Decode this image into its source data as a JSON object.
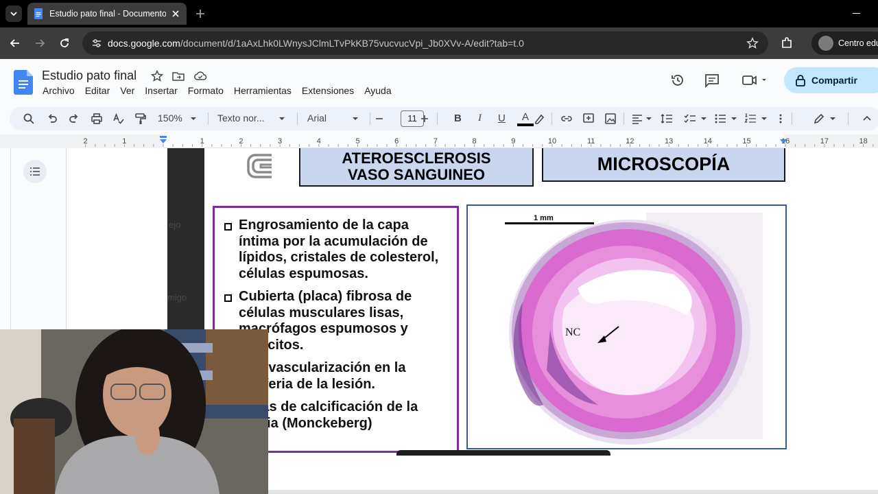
{
  "browser": {
    "tab_title": "Estudio pato final - Documento",
    "url_host": "docs.google.com",
    "url_path": "/document/d/1aAxLhk0LWnysJClmLTvPkKB75vucvucVpi_Jb0XVv-A/edit?tab=t.0",
    "profile_label": "Centro educ"
  },
  "docs": {
    "title": "Estudio pato final",
    "menu": [
      "Archivo",
      "Editar",
      "Ver",
      "Insertar",
      "Formato",
      "Herramientas",
      "Extensiones",
      "Ayuda"
    ],
    "share_label": "Compartir"
  },
  "format_toolbar": {
    "zoom": "150%",
    "style": "Texto nor...",
    "font": "Arial",
    "font_size": "11",
    "bold": "B",
    "italic": "I",
    "underline": "U",
    "text_color": "A"
  },
  "ruler": {
    "ticks": [
      "2",
      "1",
      "1",
      "2",
      "3",
      "4",
      "5",
      "6",
      "7",
      "8",
      "9",
      "10",
      "11",
      "12",
      "13",
      "14",
      "15",
      "16",
      "17",
      "18"
    ]
  },
  "slide": {
    "ghost_1": "ejo",
    "ghost_2": "migo",
    "title_left_1": "ATEROESCLEROSIS",
    "title_left_2": "VASO SANGUINEO",
    "title_right": "MICROSCOPÍA",
    "bullets": [
      "Engrosamiento de la capa íntima por la acumulación de lípidos, cristales de colesterol, células espumosas.",
      "Cubierta  (placa) fibrosa de células musculares lisas, macrófagos espumosos y linfocitos.",
      "Neo vascularización en la periferia de la lesión.",
      "Áreas de calcificación de la media (Monckeberg)"
    ],
    "scale_label": "1 mm",
    "nc_label": "NC"
  },
  "colors": {
    "share_bg": "#c2e7ff",
    "title_box_bg": "#c9d6ee",
    "bullet_border": "#7b2d9b",
    "micro_border": "#3c5a94",
    "tissue_pink": "#d86ad0"
  }
}
